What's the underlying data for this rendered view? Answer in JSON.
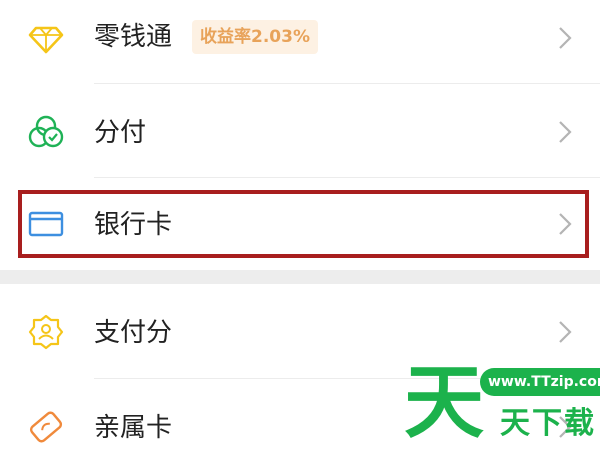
{
  "menu": {
    "items": [
      {
        "label": "零钱通",
        "badge": "收益率2.03%",
        "icon": "diamond-icon"
      },
      {
        "label": "分付",
        "icon": "fenfu-icon"
      },
      {
        "label": "银行卡",
        "icon": "bank-card-icon"
      },
      {
        "label": "支付分",
        "icon": "pay-score-icon"
      },
      {
        "label": "亲属卡",
        "icon": "family-card-icon"
      }
    ]
  },
  "colors": {
    "accent_yellow": "#f5c518",
    "accent_green": "#1fb256",
    "accent_blue": "#3d8fe0",
    "accent_orange": "#f08a3c",
    "badge_text": "#e8a35a",
    "highlight": "#a81e1e"
  },
  "watermark": {
    "url": "www.TTzip.com",
    "big_char": "天",
    "text": "天下载"
  }
}
